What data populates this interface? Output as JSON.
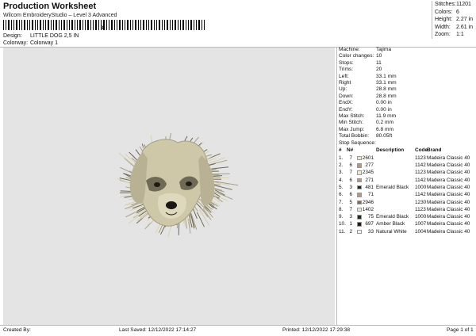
{
  "header": {
    "title": "Production Worksheet",
    "subtitle": "Wilcom EmbroideryStudio – Level 3 Advanced",
    "barcode_suffix": "3",
    "design_label": "Design:",
    "design_value": "LITTLE DOG 2,5 IN",
    "colorway_label": "Colorway:",
    "colorway_value": "Colorway 1"
  },
  "stats": [
    {
      "label": "Stitches:",
      "value": "11201"
    },
    {
      "label": "Colors:",
      "value": "6"
    },
    {
      "label": "Height:",
      "value": "2.27 in"
    },
    {
      "label": "Width:",
      "value": "2.61 in"
    },
    {
      "label": "Zoom:",
      "value": "1:1"
    }
  ],
  "info": [
    {
      "label": "Machine:",
      "value": "Tajima"
    },
    {
      "label": "Color changes:",
      "value": "10"
    },
    {
      "label": "Stops:",
      "value": "11"
    },
    {
      "label": "Trims:",
      "value": "20"
    },
    {
      "label": "Left:",
      "value": "33.1 mm"
    },
    {
      "label": "Right",
      "value": "33.1 mm"
    },
    {
      "label": "Up:",
      "value": "28.8 mm"
    },
    {
      "label": "Down:",
      "value": "28.8 mm"
    },
    {
      "label": "EndX:",
      "value": "0.00 in"
    },
    {
      "label": "EndY:",
      "value": "0.00 in"
    },
    {
      "label": "Max Stitch:",
      "value": "11.9 mm"
    },
    {
      "label": "Min Stitch:",
      "value": "0.2 mm"
    },
    {
      "label": "Max Jump:",
      "value": "6.8 mm"
    },
    {
      "label": "Total Bobbin:",
      "value": "80.05ft"
    }
  ],
  "sequence": {
    "title": "Stop Sequence:",
    "headers": {
      "hash": "#",
      "n": "N#",
      "description": "Description",
      "code": "Code",
      "brand": "Brand"
    },
    "rows": [
      {
        "idx": "1.",
        "n": "7",
        "swatch": "#efe6d2",
        "stitches": "2601",
        "description": "",
        "code": "1123",
        "brand": "Madeira Classic 40"
      },
      {
        "idx": "2.",
        "n": "6",
        "swatch": "#b59582",
        "stitches": "277",
        "description": "",
        "code": "1142",
        "brand": "Madeira Classic 40"
      },
      {
        "idx": "3.",
        "n": "7",
        "swatch": "#efe6d2",
        "stitches": "2345",
        "description": "",
        "code": "1123",
        "brand": "Madeira Classic 40"
      },
      {
        "idx": "4.",
        "n": "6",
        "swatch": "#b59582",
        "stitches": "271",
        "description": "",
        "code": "1142",
        "brand": "Madeira Classic 40"
      },
      {
        "idx": "5.",
        "n": "3",
        "swatch": "#1b2a22",
        "stitches": "481",
        "description": "Emerald Black",
        "code": "1000",
        "brand": "Madeira Classic 40"
      },
      {
        "idx": "6.",
        "n": "6",
        "swatch": "#b59582",
        "stitches": "71",
        "description": "",
        "code": "1142",
        "brand": "Madeira Classic 40"
      },
      {
        "idx": "7.",
        "n": "5",
        "swatch": "#75705e",
        "stitches": "2946",
        "description": "",
        "code": "1230",
        "brand": "Madeira Classic 40"
      },
      {
        "idx": "8.",
        "n": "7",
        "swatch": "#efe6d2",
        "stitches": "1402",
        "description": "",
        "code": "1123",
        "brand": "Madeira Classic 40"
      },
      {
        "idx": "9.",
        "n": "3",
        "swatch": "#1b2a22",
        "stitches": "75",
        "description": "Emerald Black",
        "code": "1000",
        "brand": "Madeira Classic 40"
      },
      {
        "idx": "10.",
        "n": "1",
        "swatch": "#231a14",
        "stitches": "697",
        "description": "Amber Black",
        "code": "1007",
        "brand": "Madeira Classic 40"
      },
      {
        "idx": "11.",
        "n": "2",
        "swatch": "#f4f4f0",
        "stitches": "33",
        "description": "Natural White",
        "code": "1004",
        "brand": "Madeira Classic 40"
      }
    ]
  },
  "footer": {
    "created": "Created By:",
    "saved": "Last Saved: 12/12/2022 17:14:27",
    "printed": "Printed: 12/12/2022 17:29:38",
    "page": "Page 1 of 1"
  },
  "preview": {
    "background": "#e4e4e4",
    "fur_light": "#d8d2b4",
    "fur_mid": "#a69f83",
    "fur_dark": "#6e6a55",
    "eye_color": "#1e1a14",
    "nose_color": "#1a1712"
  }
}
